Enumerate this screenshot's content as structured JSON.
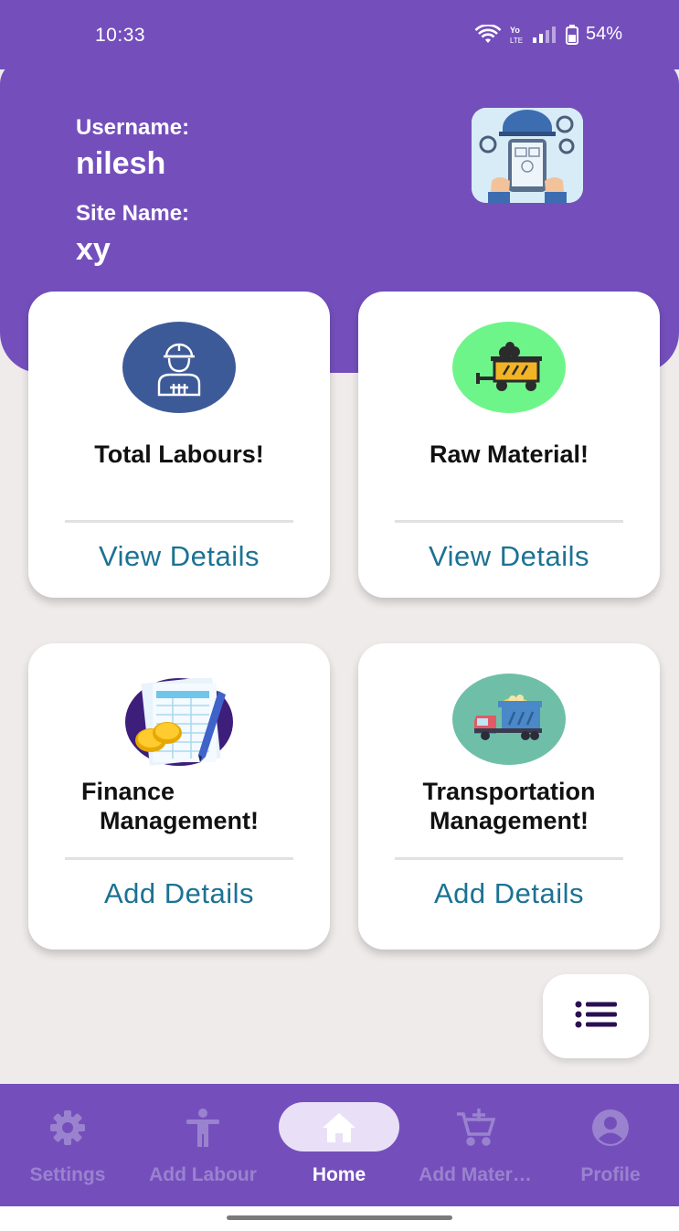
{
  "status_bar": {
    "time": "10:33",
    "battery": "54%"
  },
  "header": {
    "username_label": "Username:",
    "username_value": "nilesh",
    "site_label": "Site Name:",
    "site_value": "xy",
    "logo_icon": "construction-engineer-tablet-logo"
  },
  "cards": [
    {
      "title": "Total Labours!",
      "action": "View Details",
      "icon": "worker-helmet-icon",
      "circle_color": "#3d5a98"
    },
    {
      "title": "Raw Material!",
      "action": "View Details",
      "icon": "material-cart-icon",
      "circle_color": "#6ef58a"
    },
    {
      "title_line1": "Finance",
      "title_line2": "Management!",
      "action": "Add Details",
      "icon": "finance-documents-coins-icon",
      "circle_color": "#3d1e7a"
    },
    {
      "title_line1": "Transportation",
      "title_line2": "Management!",
      "action": "Add Details",
      "icon": "truck-icon",
      "circle_color": "#6fbfa8"
    }
  ],
  "fab": {
    "icon": "menu-list-icon"
  },
  "bottom_nav": {
    "items": [
      {
        "label": "Settings",
        "icon": "gear-icon"
      },
      {
        "label": "Add Labour",
        "icon": "person-standing-icon"
      },
      {
        "label": "Home",
        "icon": "home-icon",
        "active": true
      },
      {
        "label": "Add Mater…",
        "icon": "add-cart-icon"
      },
      {
        "label": "Profile",
        "icon": "account-circle-icon"
      }
    ]
  },
  "colors": {
    "primary": "#744fbc",
    "link": "#1c7293",
    "background": "#efebea"
  }
}
